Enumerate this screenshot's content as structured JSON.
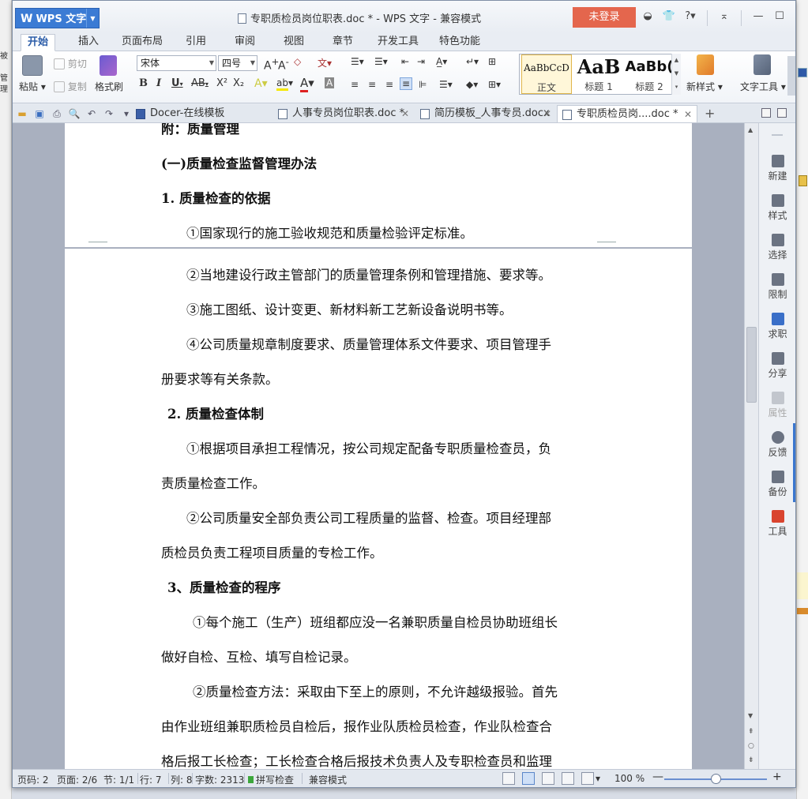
{
  "window": {
    "app_button": "WPS 文字",
    "title": "专职质检员岗位职表.doc * - WPS 文字 - 兼容模式",
    "login_button": "未登录"
  },
  "background": {
    "left_fragments": [
      "被",
      "管",
      "理"
    ]
  },
  "ribbon_tabs": [
    "开始",
    "插入",
    "页面布局",
    "引用",
    "审阅",
    "视图",
    "章节",
    "开发工具",
    "特色功能"
  ],
  "active_tab": "开始",
  "ribbon": {
    "paste": "粘贴",
    "cut": "剪切",
    "copy": "复制",
    "format_painter": "格式刷",
    "font_name": "宋体",
    "font_size": "四号",
    "new_style": "新样式",
    "text_tools": "文字工具",
    "styles": [
      {
        "sample": "AaBbCcD",
        "name": "正文"
      },
      {
        "sample": "AaB",
        "name": "标题 1"
      },
      {
        "sample": "AaBb(",
        "name": "标题 2"
      }
    ]
  },
  "doc_tabs": [
    {
      "label": "Docer-在线模板",
      "closable": false
    },
    {
      "label": "人事专员岗位职表.doc *",
      "closable": true
    },
    {
      "label": "简历模板_人事专员.docx",
      "closable": true
    },
    {
      "label": "专职质检员岗....doc *",
      "closable": true,
      "active": true
    }
  ],
  "document": {
    "page1_lines": [
      {
        "text": "附：质量管理",
        "bold": true
      },
      {
        "text": "(一)质量检查监督管理办法",
        "bold": true
      },
      {
        "text": "1. 质量检查的依据",
        "bold": true
      },
      {
        "text": "①国家现行的施工验收规范和质量检验评定标准。",
        "bold": false
      }
    ],
    "page2_lines": [
      {
        "text": "②当地建设行政主管部门的质量管理条例和管理措施、要求等。",
        "bold": false
      },
      {
        "text": "③施工图纸、设计变更、新材料新工艺新设备说明书等。",
        "bold": false
      },
      {
        "text": "④公司质量规章制度要求、质量管理体系文件要求、项目管理手",
        "bold": false
      },
      {
        "text": "册要求等有关条款。",
        "bold": false
      },
      {
        "text": "2. 质量检查体制",
        "bold": true
      },
      {
        "text": "①根据项目承担工程情况，按公司规定配备专职质量检查员，负",
        "bold": false
      },
      {
        "text": "责质量检查工作。",
        "bold": false
      },
      {
        "text": "②公司质量安全部负责公司工程质量的监督、检查。项目经理部",
        "bold": false
      },
      {
        "text": "质检员负责工程项目质量的专检工作。",
        "bold": false
      },
      {
        "text": "3、质量检查的程序",
        "bold": true
      },
      {
        "text": "①每个施工（生产）班组都应没一名兼职质量自检员协助班组长",
        "bold": false
      },
      {
        "text": "做好自检、互检、填写自检记录。",
        "bold": false
      },
      {
        "text": "②质量检查方法：采取由下至上的原则，不允许越级报验。首先",
        "bold": false
      },
      {
        "text": "由作业班组兼职质检员自检后，报作业队质检员检查，作业队检查合",
        "bold": false
      },
      {
        "text": "格后报工长检查；工长检查合格后报技术负责人及专职检查员和监理",
        "bold": false
      }
    ]
  },
  "side_pane": [
    {
      "label": "新建",
      "icon": "new-doc-icon",
      "enabled": true
    },
    {
      "label": "样式",
      "icon": "style-icon",
      "enabled": true
    },
    {
      "label": "选择",
      "icon": "select-icon",
      "enabled": true
    },
    {
      "label": "限制",
      "icon": "restrict-icon",
      "enabled": true
    },
    {
      "label": "求职",
      "icon": "briefcase-icon",
      "enabled": true
    },
    {
      "label": "分享",
      "icon": "share-icon",
      "enabled": true
    },
    {
      "label": "属性",
      "icon": "properties-icon",
      "enabled": false
    },
    {
      "label": "反馈",
      "icon": "feedback-icon",
      "enabled": true
    },
    {
      "label": "备份",
      "icon": "backup-icon",
      "enabled": true
    },
    {
      "label": "工具",
      "icon": "toolbox-icon",
      "enabled": true
    }
  ],
  "statusbar": {
    "page_num": "页码: 2",
    "pages": "页面: 2/6",
    "section": "节: 1/1",
    "row": "行: 7",
    "column": "列: 8",
    "word_count": "字数: 2313",
    "spell_check": "拼写检查",
    "compat_mode": "兼容模式",
    "zoom": "100 %"
  },
  "colors": {
    "accent": "#3b7bd4",
    "login": "#e4664d",
    "toolbox_icon": "#d9442f"
  }
}
